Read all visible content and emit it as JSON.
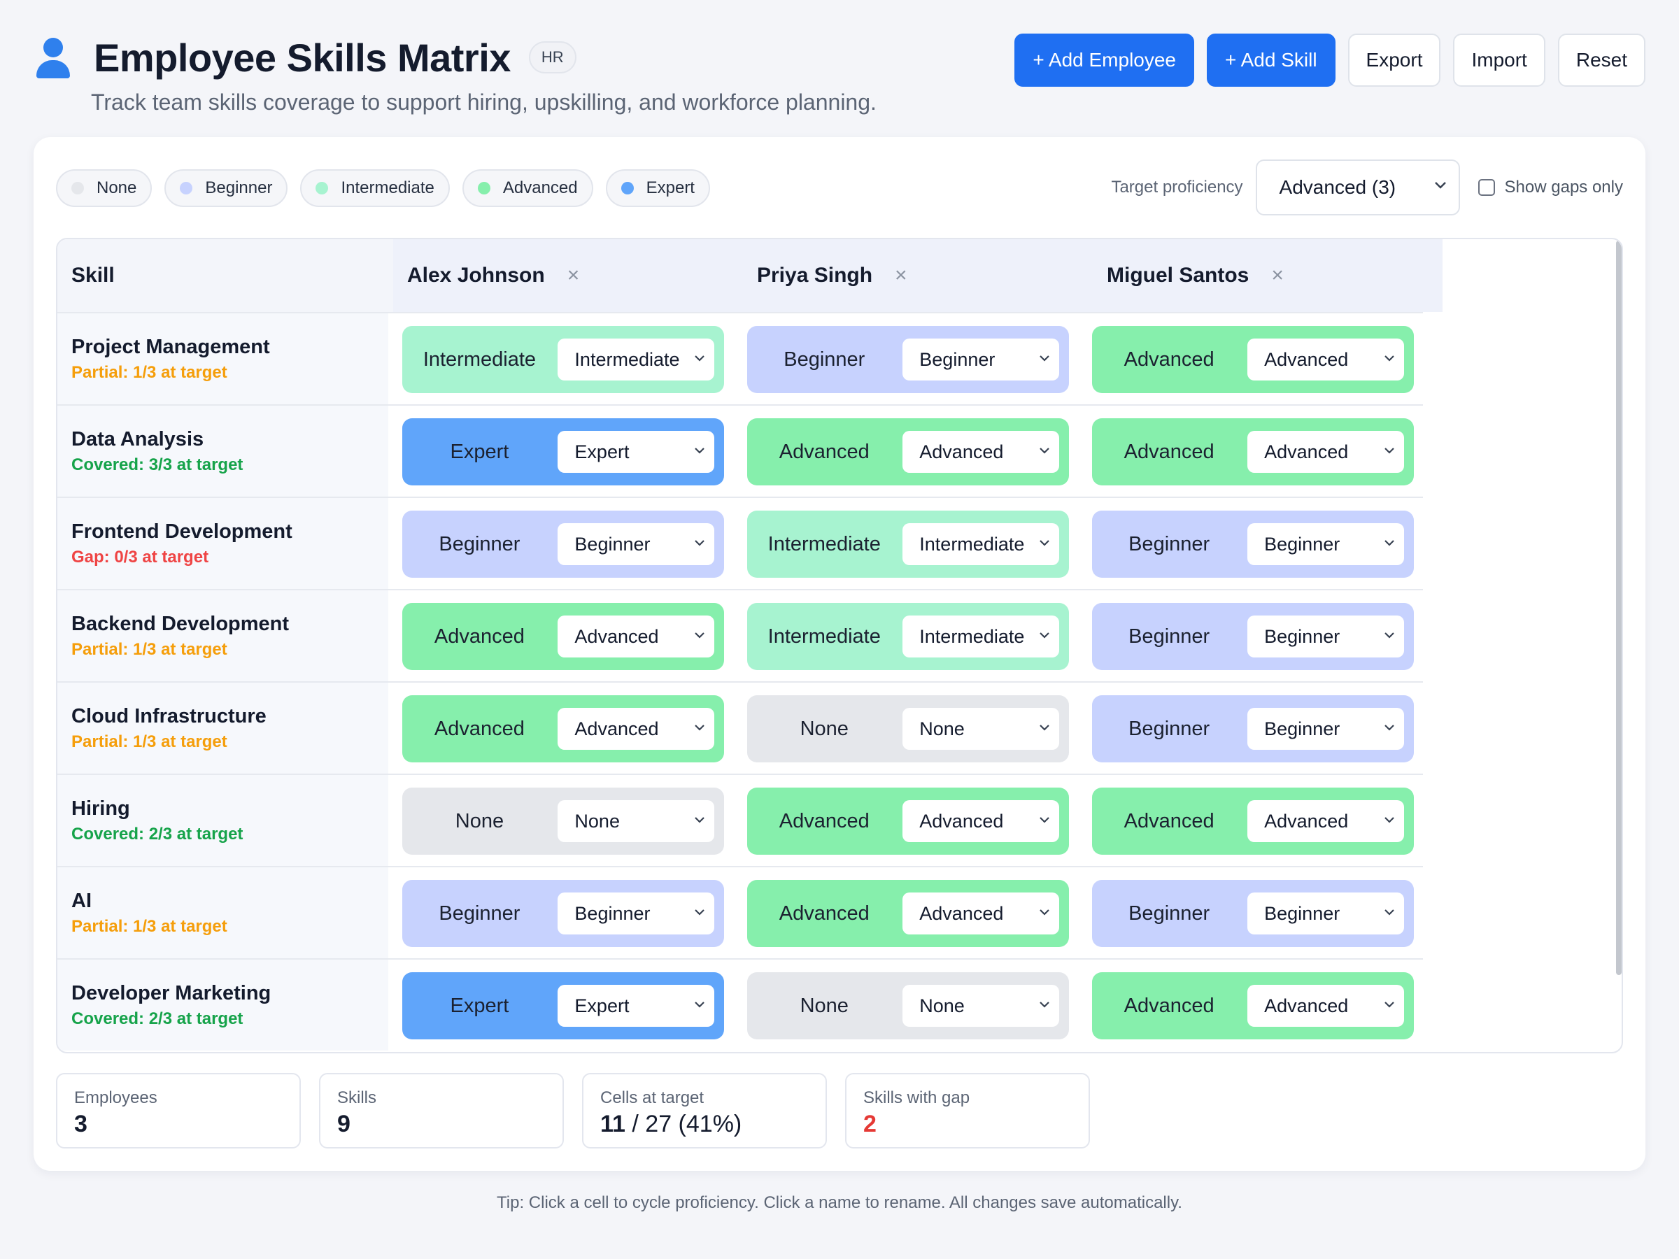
{
  "header": {
    "title": "Employee Skills Matrix",
    "badge": "HR",
    "subtitle": "Track team skills coverage to support hiring, upskilling, and workforce planning.",
    "actions": {
      "add_employee": "+ Add Employee",
      "add_skill": "+ Add Skill",
      "export": "Export",
      "import": "Import",
      "reset": "Reset"
    }
  },
  "legend": [
    {
      "label": "None",
      "color": "#e5e7eb"
    },
    {
      "label": "Beginner",
      "color": "#c7d2fe"
    },
    {
      "label": "Intermediate",
      "color": "#a7f3d0"
    },
    {
      "label": "Advanced",
      "color": "#86efac"
    },
    {
      "label": "Expert",
      "color": "#60a5fa"
    }
  ],
  "controls": {
    "target_label": "Target proficiency",
    "target_value": "Advanced (3)",
    "show_gaps_label": "Show gaps only",
    "show_gaps_checked": false
  },
  "table": {
    "skill_header": "Skill",
    "employees": [
      "Alex Johnson",
      "Priya Singh",
      "Miguel Santos"
    ],
    "remove_icon": "×",
    "rows": [
      {
        "skill": "Project Management",
        "status": "Partial: 1/3 at target",
        "status_type": "partial",
        "levels": [
          "Intermediate",
          "Beginner",
          "Advanced"
        ]
      },
      {
        "skill": "Data Analysis",
        "status": "Covered: 3/3 at target",
        "status_type": "covered",
        "levels": [
          "Expert",
          "Advanced",
          "Advanced"
        ]
      },
      {
        "skill": "Frontend Development",
        "status": "Gap: 0/3 at target",
        "status_type": "gap",
        "levels": [
          "Beginner",
          "Intermediate",
          "Beginner"
        ]
      },
      {
        "skill": "Backend Development",
        "status": "Partial: 1/3 at target",
        "status_type": "partial",
        "levels": [
          "Advanced",
          "Intermediate",
          "Beginner"
        ]
      },
      {
        "skill": "Cloud Infrastructure",
        "status": "Partial: 1/3 at target",
        "status_type": "partial",
        "levels": [
          "Advanced",
          "None",
          "Beginner"
        ]
      },
      {
        "skill": "Hiring",
        "status": "Covered: 2/3 at target",
        "status_type": "covered",
        "levels": [
          "None",
          "Advanced",
          "Advanced"
        ]
      },
      {
        "skill": "AI",
        "status": "Partial: 1/3 at target",
        "status_type": "partial",
        "levels": [
          "Beginner",
          "Advanced",
          "Beginner"
        ]
      },
      {
        "skill": "Developer Marketing",
        "status": "Covered: 2/3 at target",
        "status_type": "covered",
        "levels": [
          "Expert",
          "None",
          "Advanced"
        ]
      }
    ]
  },
  "status_colors": {
    "partial": "#f59e0b",
    "covered": "#16a34a",
    "gap": "#ef4444"
  },
  "stats": [
    {
      "label": "Employees",
      "value": "3"
    },
    {
      "label": "Skills",
      "value": "9"
    },
    {
      "label": "Cells at target",
      "value_strong": "11",
      "value_rest": " / 27 (41%)"
    },
    {
      "label": "Skills with gap",
      "value": "2"
    }
  ],
  "tip": "Tip: Click a cell to cycle proficiency. Click a name to rename. All changes save automatically."
}
